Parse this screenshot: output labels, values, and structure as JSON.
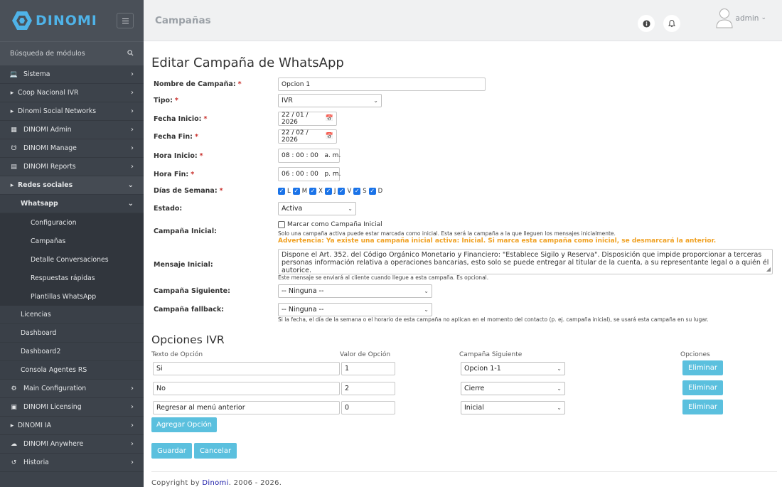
{
  "brand": {
    "name": "DINOMI",
    "accent": "#4fb3e8"
  },
  "sidebar": {
    "search_placeholder": "Búsqueda de módulos",
    "items": [
      {
        "label": "Sistema",
        "icon": "laptop-icon"
      },
      {
        "label": "Coop Nacional IVR",
        "icon": "caret-right-icon"
      },
      {
        "label": "Dinomi Social Networks",
        "icon": "caret-right-icon"
      },
      {
        "label": "DINOMI Admin",
        "icon": "sitemap-icon"
      },
      {
        "label": "DINOMI Manage",
        "icon": "headset-icon"
      },
      {
        "label": "DINOMI Reports",
        "icon": "bar-chart-icon"
      },
      {
        "label": "Redes sociales",
        "icon": "caret-right-icon"
      },
      {
        "label": "Whatsapp"
      },
      {
        "label": "Configuracion"
      },
      {
        "label": "Campañas"
      },
      {
        "label": "Detalle Conversaciones"
      },
      {
        "label": "Respuestas rápidas"
      },
      {
        "label": "Plantillas WhatsApp"
      },
      {
        "label": "Licencias"
      },
      {
        "label": "Dashboard"
      },
      {
        "label": "Dashboard2"
      },
      {
        "label": "Consola Agentes RS"
      },
      {
        "label": "Main Configuration",
        "icon": "gear-icon"
      },
      {
        "label": "DINOMI Licensing",
        "icon": "id-card-icon"
      },
      {
        "label": "DINOMI IA",
        "icon": "caret-right-icon"
      },
      {
        "label": "DINOMI Anywhere",
        "icon": "cloud-icon"
      },
      {
        "label": "Historia",
        "icon": "history-icon"
      }
    ]
  },
  "header": {
    "title": "Campañas",
    "user": "admin"
  },
  "form": {
    "heading": "Editar Campaña de WhatsApp",
    "name_label": "Nombre de Campaña:",
    "name_value": "Opcion 1",
    "tipo_label": "Tipo:",
    "tipo_value": "IVR",
    "fecha_inicio_label": "Fecha Inicio:",
    "fecha_inicio_value": "22 / 01 / 2026",
    "fecha_fin_label": "Fecha Fin:",
    "fecha_fin_value": "22 / 02 / 2026",
    "hora_inicio_label": "Hora Inicio:",
    "hora_inicio_value": "08 : 00 : 00   a. m.",
    "hora_fin_label": "Hora Fin:",
    "hora_fin_value": "06 : 00 : 00   p. m.",
    "dias_label": "Días de Semana:",
    "dias": [
      "L",
      "M",
      "X",
      "J",
      "V",
      "S",
      "D"
    ],
    "estado_label": "Estado:",
    "estado_value": "Activa",
    "inicial_label": "Campaña Inicial:",
    "inicial_checkbox": "Marcar como Campaña Inicial",
    "inicial_help": "Solo una campaña activa puede estar marcada como inicial. Esta será la campaña a la que lleguen los mensajes inicialmente.",
    "inicial_warning": "Advertencia: Ya existe una campaña inicial activa: Inicial. Si marca esta campaña como inicial, se desmarcará la anterior.",
    "mensaje_label": "Mensaje Inicial:",
    "mensaje_value": "Dispone el Art. 352. del Código Orgánico Monetario y Financiero: \"Establece Sigilo y Reserva\". Disposición que impide proporcionar a terceras personas información relativa a operaciones bancarias, esto solo se puede entregar al titular de la cuenta, a su representante legal o a quién él autorice.",
    "mensaje_help": "Este mensaje se enviará al cliente cuando llegue a esta campaña. Es opcional.",
    "siguiente_label": "Campaña Siguiente:",
    "siguiente_value": "-- Ninguna --",
    "fallback_label": "Campaña fallback:",
    "fallback_value": "-- Ninguna --",
    "fallback_help": "Si la fecha, el día de la semana o el horario de esta campaña no aplican en el momento del contacto (p. ej. campaña inicial), se usará esta campaña en su lugar."
  },
  "ivr": {
    "heading": "Opciones IVR",
    "col_texto": "Texto de Opción",
    "col_valor": "Valor de Opción",
    "col_siguiente": "Campaña Siguiente",
    "col_opciones": "Opciones",
    "rows": [
      {
        "texto": "Si",
        "valor": "1",
        "siguiente": "Opcion 1-1",
        "action": "Eliminar"
      },
      {
        "texto": "No",
        "valor": "2",
        "siguiente": "Cierre",
        "action": "Eliminar"
      },
      {
        "texto": "Regresar al menú anterior",
        "valor": "0",
        "siguiente": "Inicial",
        "action": "Eliminar"
      }
    ],
    "add_label": "Agregar Opción"
  },
  "actions": {
    "save": "Guardar",
    "cancel": "Cancelar"
  },
  "footer": {
    "prefix": "Copyright by ",
    "link": "Dinomi",
    "suffix": ". 2006 - 2026."
  }
}
